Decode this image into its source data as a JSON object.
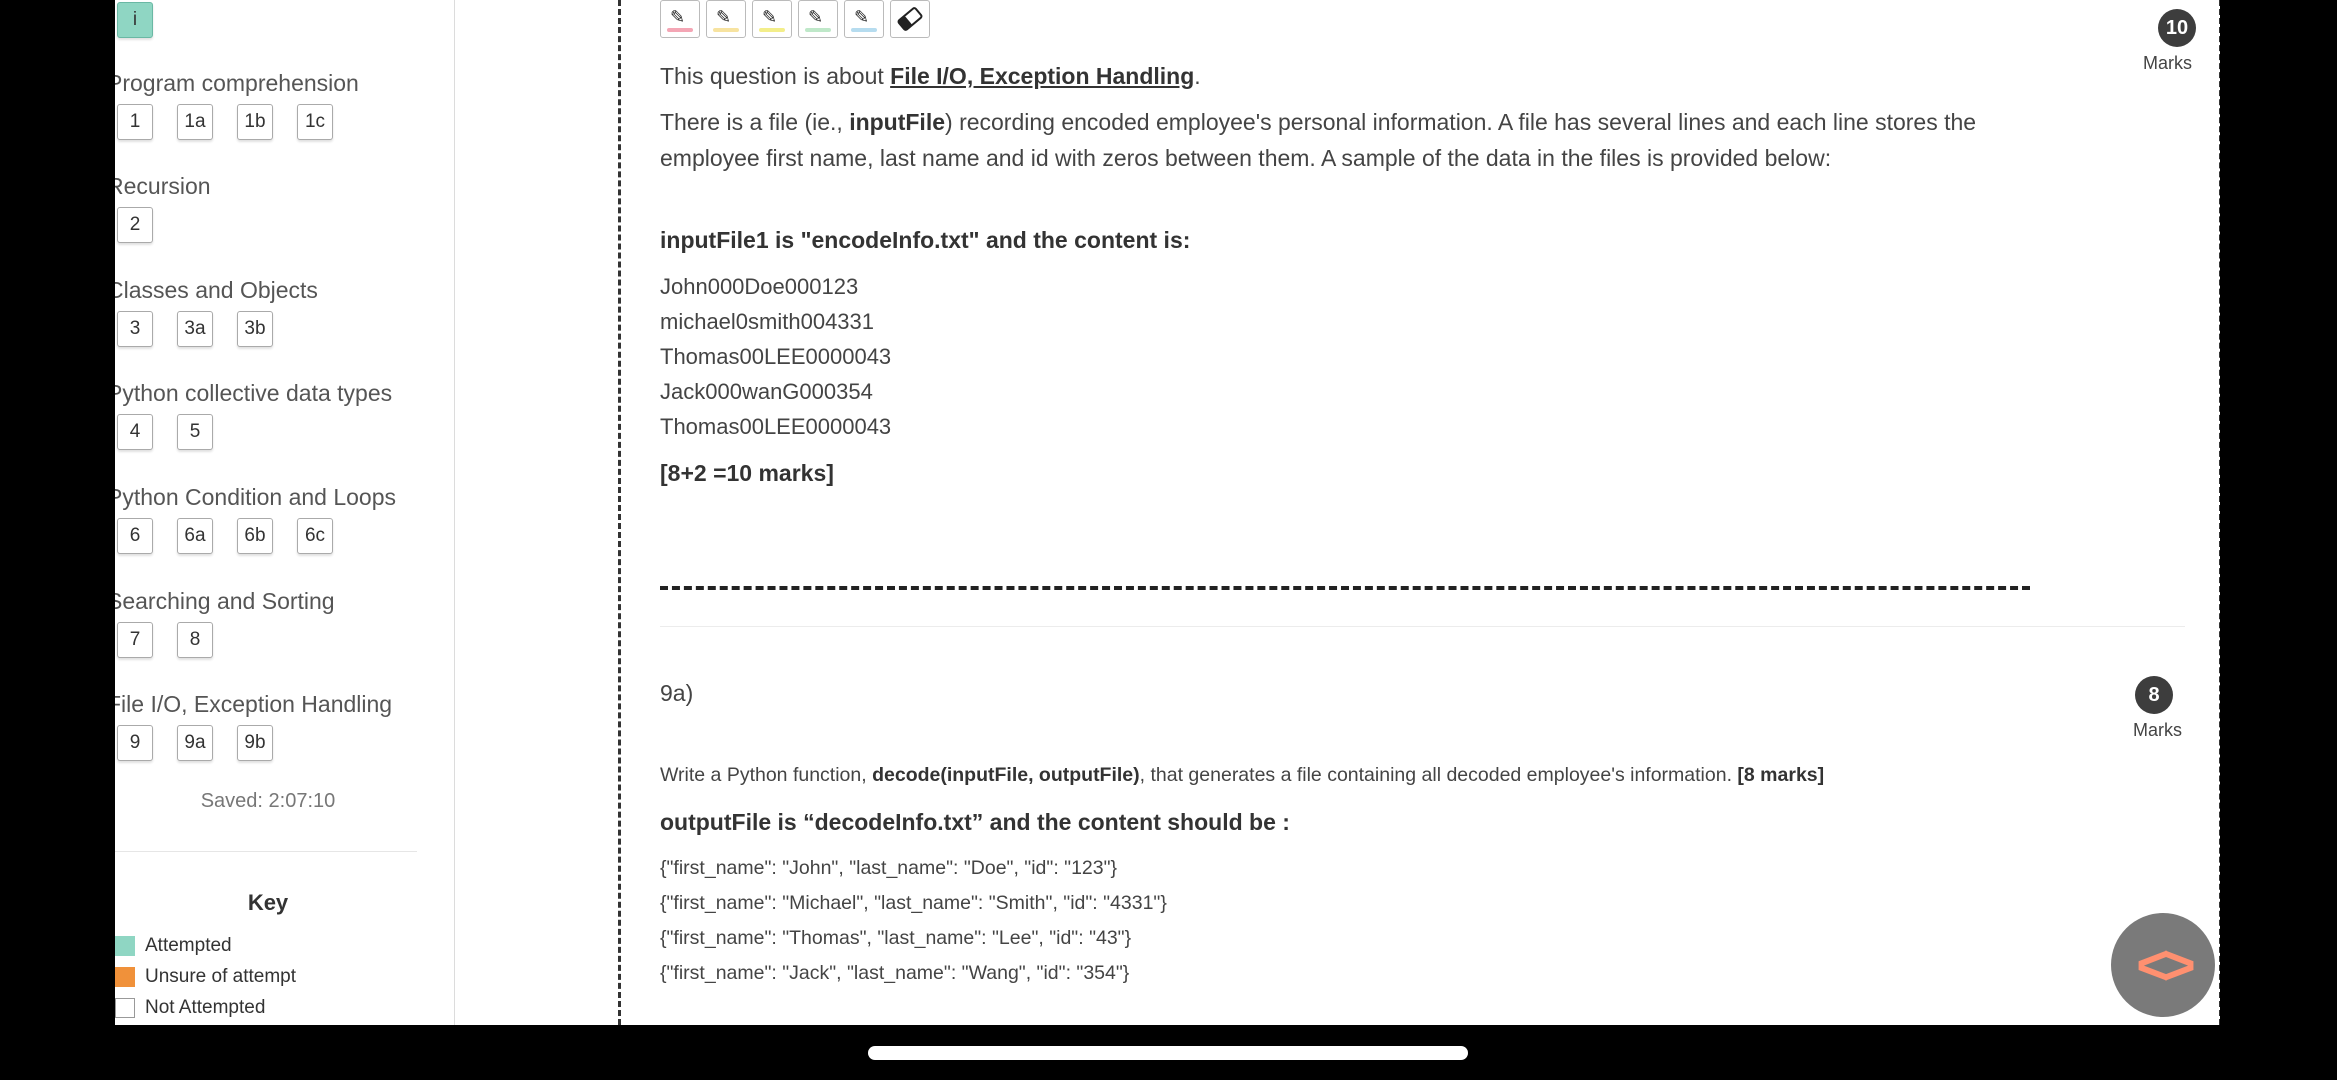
{
  "sidebar": {
    "top_button": "i",
    "sections": [
      {
        "title": "Program comprehension",
        "buttons": [
          "1",
          "1a",
          "1b",
          "1c"
        ]
      },
      {
        "title": "Recursion",
        "buttons": [
          "2"
        ]
      },
      {
        "title": "Classes and Objects",
        "buttons": [
          "3",
          "3a",
          "3b"
        ]
      },
      {
        "title": "Python collective data types",
        "buttons": [
          "4",
          "5"
        ]
      },
      {
        "title": "Python Condition and Loops",
        "buttons": [
          "6",
          "6a",
          "6b",
          "6c"
        ]
      },
      {
        "title": "Searching and Sorting",
        "buttons": [
          "7",
          "8"
        ]
      },
      {
        "title": "File I/O, Exception Handling",
        "buttons": [
          "9",
          "9a",
          "9b"
        ]
      }
    ],
    "saved": "Saved: 2:07:10",
    "key": {
      "title": "Key",
      "items": [
        {
          "label": "Attempted",
          "color": "#8fd6c3"
        },
        {
          "label": "Unsure of attempt",
          "color": "#f0913a"
        },
        {
          "label": "Not Attempted",
          "color": "#ffffff"
        }
      ]
    }
  },
  "toolbar": {
    "tools": [
      {
        "icon": "pen-icon",
        "color": "#f4a6b5"
      },
      {
        "icon": "pen-icon",
        "color": "#f7e3a0"
      },
      {
        "icon": "pen-icon",
        "color": "#f3ee8a"
      },
      {
        "icon": "pen-icon",
        "color": "#bfe8c9"
      },
      {
        "icon": "pen-icon",
        "color": "#b6dcef"
      },
      {
        "icon": "eraser-icon",
        "color": ""
      }
    ]
  },
  "question": {
    "marks_total": "10",
    "marks_label": "Marks",
    "intro_prefix": "This question is about ",
    "intro_topic": "File I/O, Exception Handling",
    "intro_suffix": ".",
    "para1_a": "There is a file (ie., ",
    "para1_b": "inputFile",
    "para1_c": ") recording encoded employee's personal information. A file has several lines and each line stores the",
    "para2": "employee first name, last name and id with zeros between them. A sample of the data in the files is provided below:",
    "input_heading": "inputFile1 is \"encodeInfo.txt\" and the content is:",
    "input_lines": [
      "John000Doe000123",
      "michael0smith004331",
      "Thomas00LEE0000043",
      "Jack000wanG000354",
      "Thomas00LEE0000043"
    ],
    "marks_breakdown": "[8+2 =10 marks]"
  },
  "subquestion": {
    "label": "9a)",
    "marks": "8",
    "marks_label": "Marks",
    "prompt_a": "Write a Python function, ",
    "prompt_b": "decode(inputFile, outputFile)",
    "prompt_c": ", that generates a file containing all decoded employee's information. ",
    "prompt_d": "[8 marks]",
    "output_heading": "outputFile is “decodeInfo.txt” and the content should be :",
    "output_lines": [
      "{\"first_name\": \"John\",  \"last_name\": \"Doe\",  \"id\": \"123\"}",
      "{\"first_name\": \"Michael\", \"last_name\": \"Smith\", \"id\": \"4331\"}",
      "{\"first_name\": \"Thomas\", \"last_name\": \"Lee\", \"id\": \"43\"}",
      "{\"first_name\": \"Jack\", \"last_name\": \"Wang\", \"id\": \"354\"}"
    ]
  },
  "fab": {
    "icon": "code-icon"
  }
}
